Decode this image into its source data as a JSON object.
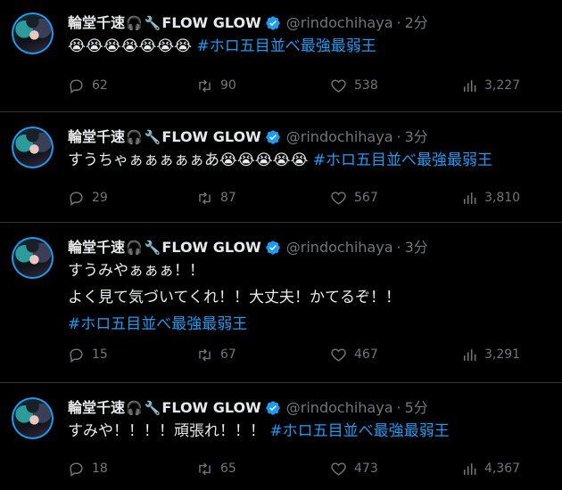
{
  "tweets": [
    {
      "name": "輪堂千速",
      "name_suffix": "FLOW GLOW",
      "handle": "@rindochihaya",
      "time": "2分",
      "lines": [
        {
          "text": "😭😭😭😭😭😭😭",
          "hashtag": "#ホロ五目並べ最強最弱王"
        }
      ],
      "replies": "62",
      "retweets": "90",
      "likes": "538",
      "views": "3,227"
    },
    {
      "name": "輪堂千速",
      "name_suffix": "FLOW GLOW",
      "handle": "@rindochihaya",
      "time": "3分",
      "lines": [
        {
          "text": "すうちゃぁぁぁぁぁあ😭😭😭😭😭",
          "hashtag": "#ホロ五目並べ最強最弱王"
        }
      ],
      "replies": "29",
      "retweets": "87",
      "likes": "567",
      "views": "3,810"
    },
    {
      "name": "輪堂千速",
      "name_suffix": "FLOW GLOW",
      "handle": "@rindochihaya",
      "time": "3分",
      "lines": [
        {
          "text": "すうみやぁぁぁ！！",
          "hashtag": ""
        },
        {
          "text": "よく見て気づいてくれ！！大丈夫！かてるぞ！！",
          "hashtag": ""
        },
        {
          "text": "",
          "hashtag": "#ホロ五目並べ最強最弱王"
        }
      ],
      "replies": "15",
      "retweets": "67",
      "likes": "467",
      "views": "3,291"
    },
    {
      "name": "輪堂千速",
      "name_suffix": "FLOW GLOW",
      "handle": "@rindochihaya",
      "time": "5分",
      "lines": [
        {
          "text": "すみや！！！！頑張れ！！！",
          "hashtag": "#ホロ五目並べ最強最弱王"
        }
      ],
      "replies": "18",
      "retweets": "65",
      "likes": "473",
      "views": "4,367"
    }
  ],
  "icons": {
    "headphone": "headphones-icon",
    "wrench": "wrench-icon",
    "verified": "verified-badge-icon",
    "reply": "reply-icon",
    "retweet": "retweet-icon",
    "like": "heart-icon",
    "views": "views-icon"
  },
  "colors": {
    "background": "#000000",
    "text": "#e7e9ea",
    "muted": "#71767b",
    "accent": "#1d9bf0",
    "divider": "#2f3336"
  }
}
